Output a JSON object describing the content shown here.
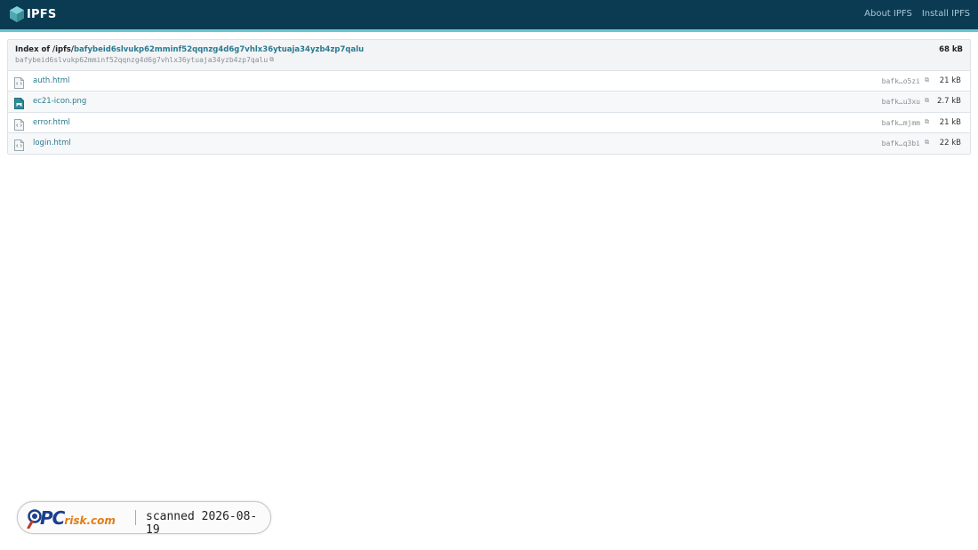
{
  "header": {
    "logo_text": "IPFS",
    "nav": [
      {
        "label": "About IPFS"
      },
      {
        "label": "Install IPFS"
      }
    ],
    "colors": {
      "bar": "#0b3a53",
      "stripe": "#69c4cd"
    }
  },
  "listing": {
    "title_prefix": "Index of /ipfs/",
    "title_cid": "bafybeid6slvukp62mminf52qqnzg4d6g7vhlx36ytuaja34yzb4zp7qalu",
    "cid": "bafybeid6slvukp62mminf52qqnzg4d6g7vhlx36ytuaja34yzb4zp7qalu",
    "total_size": "68 kB",
    "files": [
      {
        "name": "auth.html",
        "cid": "bafk…o5zi",
        "size": "21 kB",
        "icon": "html-file-icon"
      },
      {
        "name": "ec21-icon.png",
        "cid": "bafk…u3xu",
        "size": "2.7 kB",
        "icon": "image-file-icon"
      },
      {
        "name": "error.html",
        "cid": "bafk…mjmm",
        "size": "21 kB",
        "icon": "html-file-icon"
      },
      {
        "name": "login.html",
        "cid": "bafk…q3bi",
        "size": "22 kB",
        "icon": "html-file-icon"
      }
    ]
  },
  "watermark": {
    "logo_pc": "PC",
    "logo_rest": "risk.com",
    "text": "scanned 2026-08-19"
  }
}
